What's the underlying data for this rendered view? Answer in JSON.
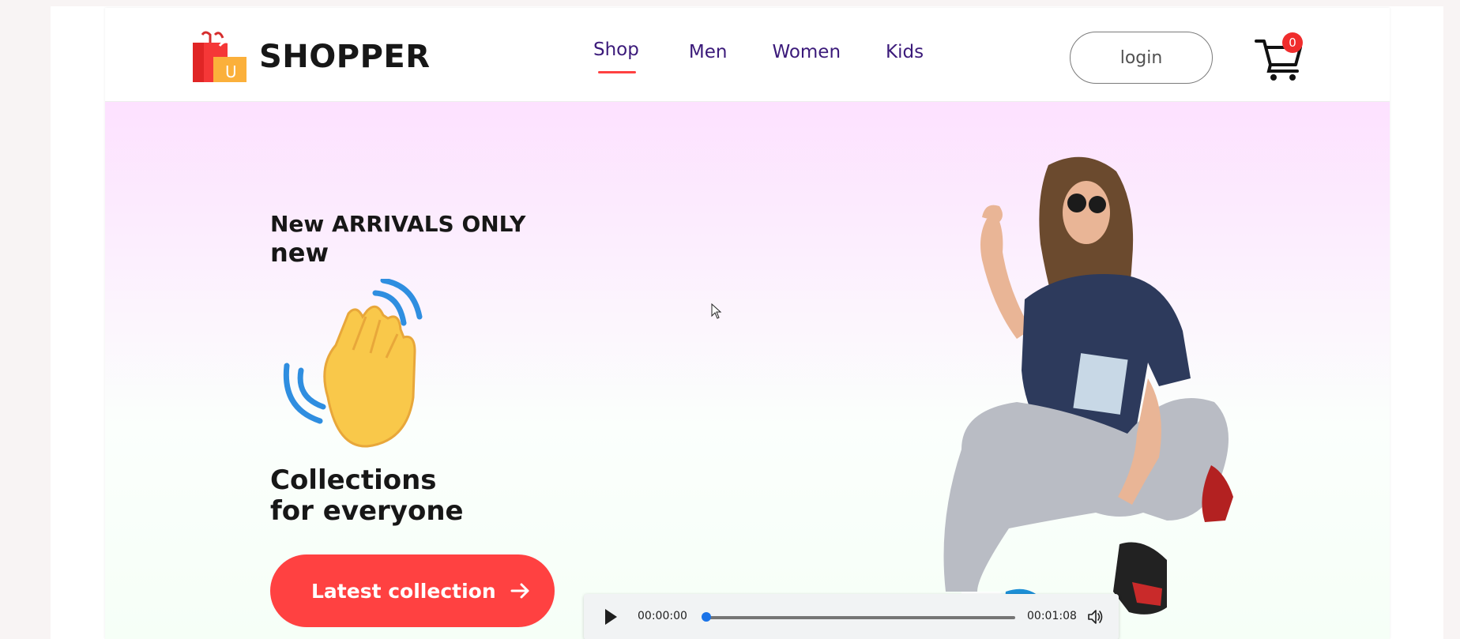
{
  "brand": {
    "name": "SHOPPER",
    "logo_icon": "shopping-bag-icon",
    "logo_letter": "U"
  },
  "nav": {
    "items": [
      {
        "label": "Shop",
        "active": true
      },
      {
        "label": "Men",
        "active": false
      },
      {
        "label": "Women",
        "active": false
      },
      {
        "label": "Kids",
        "active": false
      }
    ]
  },
  "header": {
    "login_label": "login",
    "cart_count": "0",
    "cart_icon": "cart-icon"
  },
  "hero": {
    "label_line1": "New ARRIVALS ONLY",
    "label_line2": "new",
    "title_line1": "Collections",
    "title_line2": "for everyone",
    "button_label": "Latest collection",
    "hand_icon": "waving-hand-icon",
    "model_image": "model-photo"
  },
  "audio": {
    "current_time": "00:00:00",
    "total_time": "00:01:08",
    "progress": 0
  },
  "colors": {
    "accent": "#ff4141",
    "nav_text": "#3b1a7a",
    "hero_top": "#fde1ff",
    "hero_bottom": "#f6fff7"
  }
}
